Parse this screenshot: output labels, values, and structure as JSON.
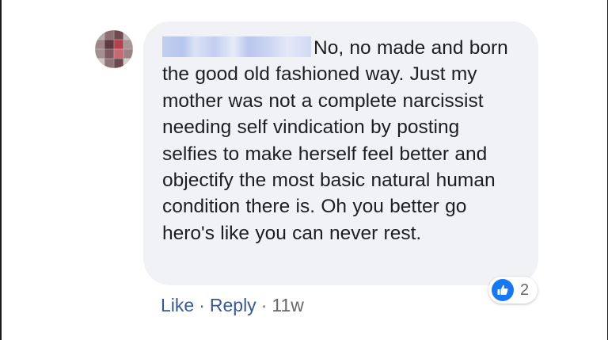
{
  "comment": {
    "author_name": "",
    "text": "No, no made and born the good old fashioned way. Just my mother was not a complete narcissist needing self vindication by posting selfies to make herself feel better and objectify the most basic natural human condition there is. Oh you better go hero's like you can never rest.",
    "reactions": {
      "icon": "thumbs-up-icon",
      "count": "2",
      "color": "#1877f2"
    },
    "actions": {
      "like_label": "Like",
      "reply_label": "Reply",
      "separator": "·",
      "timestamp": "11w"
    }
  },
  "colors": {
    "bubble": "#f1f2f6",
    "link": "#385898",
    "meta": "#65676b",
    "text": "#1c1e21"
  }
}
